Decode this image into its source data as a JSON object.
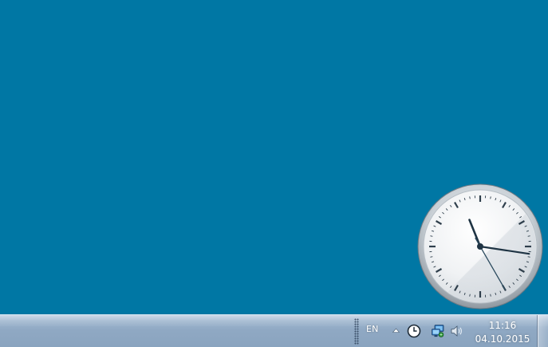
{
  "desktop": {
    "background_color": "#0077a4"
  },
  "gadget": {
    "type": "clock",
    "hour": 11,
    "minute": 16,
    "second": 25
  },
  "taskbar": {
    "language": "EN",
    "tray_icons": [
      "show-hidden-icons-arrow",
      "clock-icon",
      "network-icon",
      "volume-icon"
    ],
    "clock": {
      "time": "11:16",
      "date": "04.10.2015"
    }
  }
}
